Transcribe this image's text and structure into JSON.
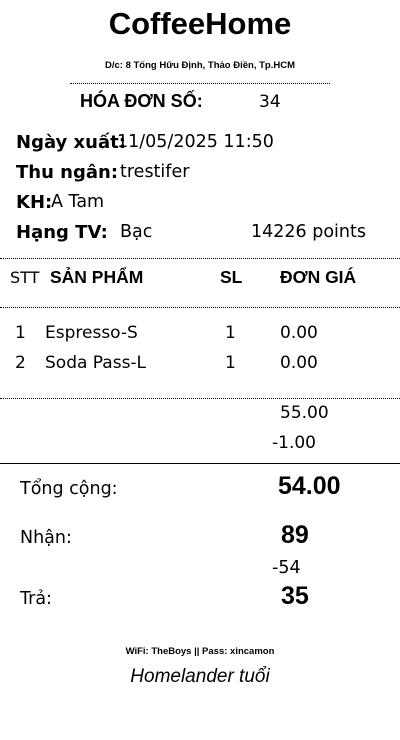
{
  "shop": {
    "name": "CoffeeHome",
    "address": "D/c: 8 Tống Hữu Định, Thảo Điền, Tp.HCM"
  },
  "invoice": {
    "label": "HÓA ĐƠN SỐ:",
    "number": "34"
  },
  "info": {
    "date_label": "Ngày xuất:",
    "date_value": "11/05/2025 11:50",
    "cashier_label": "Thu ngân:",
    "cashier_value": "trestifer",
    "customer_label": "KH:",
    "customer_value": "A Tam",
    "tier_label": "Hạng TV:",
    "tier_value": "Bạc",
    "points_value": "14226 points"
  },
  "table": {
    "headers": {
      "stt": "STT",
      "product": "SẢN PHẨM",
      "qty": "SL",
      "price": "ĐƠN GIÁ"
    },
    "rows": [
      {
        "stt": "1",
        "product": "Espresso-S",
        "qty": "1",
        "price": "0.00"
      },
      {
        "stt": "2",
        "product": "Soda Pass-L",
        "qty": "1",
        "price": "0.00"
      }
    ]
  },
  "subtotals": {
    "amount": "55.00",
    "discount": "-1.00"
  },
  "totals": {
    "total_label": "Tổng cộng:",
    "total_value": "54.00",
    "received_label": "Nhận:",
    "received_value": "89",
    "received_note": "-54",
    "change_label": "Trả:",
    "change_value": "35"
  },
  "footer": {
    "wifi": "WiFi: TheBoys || Pass: xincamon",
    "slogan": "Homelander tuổi"
  }
}
